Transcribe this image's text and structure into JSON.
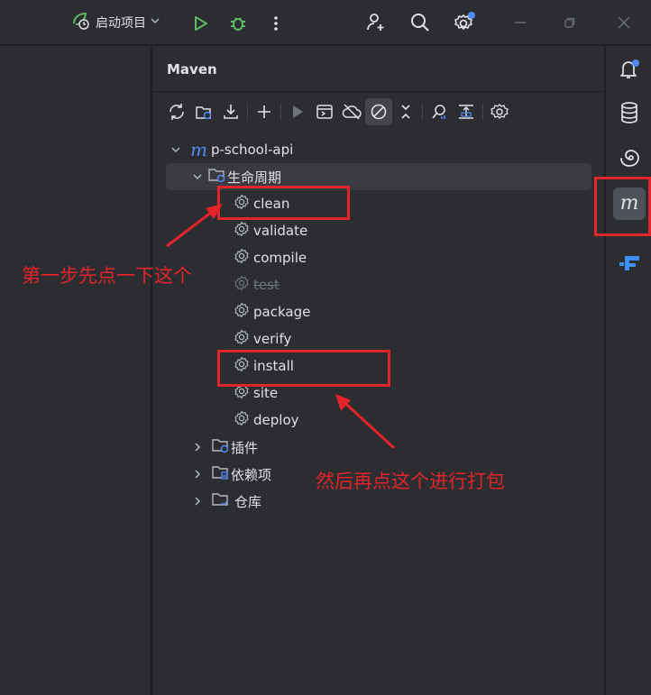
{
  "titlebar": {
    "run_config_label": "启动项目"
  },
  "maven": {
    "title": "Maven",
    "project": {
      "name": "p-school-api",
      "lifecycle_label": "生命周期",
      "lifecycle_items": [
        "clean",
        "validate",
        "compile",
        "test",
        "package",
        "verify",
        "install",
        "site",
        "deploy"
      ],
      "skipped_item": "test",
      "plugins_label": "插件",
      "dependencies_label": "依赖项",
      "repositories_label": "仓库"
    }
  },
  "annotations": {
    "step1": "第一步先点一下这个",
    "step2": "然后再点这个进行打包",
    "color": "#e3242b"
  },
  "colors": {
    "accent_blue": "#548af7",
    "run_green": "#5fb865",
    "background": "#2b2d30"
  }
}
